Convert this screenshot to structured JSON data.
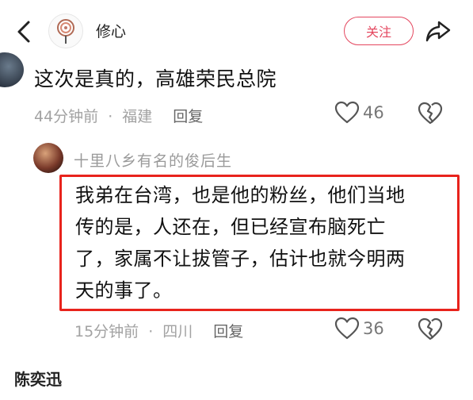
{
  "header": {
    "username": "修心",
    "follow_label": "关注"
  },
  "comment": {
    "text": "这次是真的，高雄荣民总院",
    "time": "44分钟前",
    "dot": "·",
    "location": "福建",
    "reply_label": "回复",
    "likes": "46"
  },
  "reply": {
    "author": "十里八乡有名的俊后生",
    "lines": [
      "我弟在台湾，也是他的粉丝，他们当地",
      "传的是，人还在，但已经宣布脑死亡",
      "了，家属不让拔管子，估计也就今明两",
      "天的事了。"
    ],
    "time": "15分钟前",
    "dot": "·",
    "location": "四川",
    "reply_label": "回复",
    "likes": "36"
  },
  "next_comment": {
    "author": "陈奕迅"
  },
  "colors": {
    "accent": "#e4475f",
    "highlight_border": "#e8231c",
    "meta_text": "#a2a2a2"
  }
}
